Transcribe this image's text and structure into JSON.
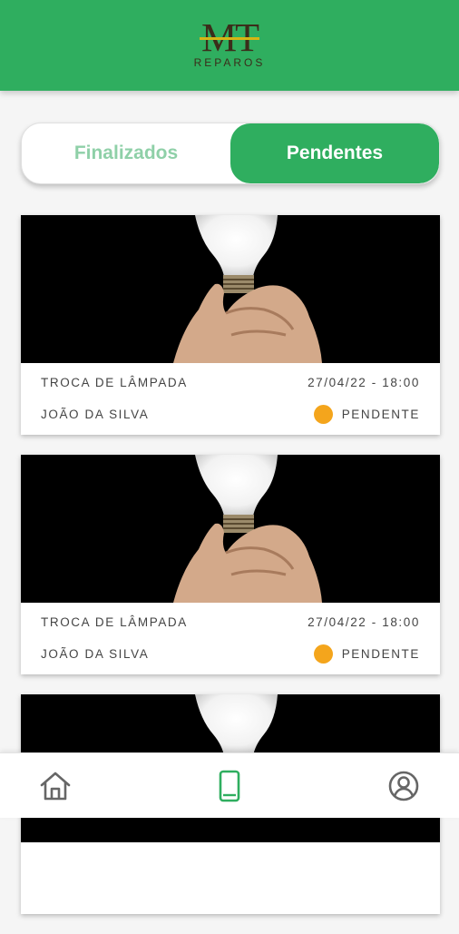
{
  "app": {
    "logo_text": "MT",
    "logo_subtitle": "REPAROS"
  },
  "tabs": [
    {
      "label": "Finalizados",
      "active": false
    },
    {
      "label": "Pendentes",
      "active": true
    }
  ],
  "services": [
    {
      "title": "TROCA DE LÂMPADA",
      "datetime": "27/04/22 - 18:00",
      "client": "JOÃO DA SILVA",
      "status": "PENDENTE",
      "image": "light-bulb-photo"
    },
    {
      "title": "TROCA DE LÂMPADA",
      "datetime": "27/04/22 - 18:00",
      "client": "JOÃO DA SILVA",
      "status": "PENDENTE",
      "image": "light-bulb-photo"
    },
    {
      "title": "",
      "datetime": "",
      "client": "",
      "status": "",
      "image": "light-bulb-photo"
    }
  ],
  "bottom_nav": [
    {
      "icon": "home-icon",
      "active": false
    },
    {
      "icon": "tablet-icon",
      "active": true
    },
    {
      "icon": "profile-icon",
      "active": false
    }
  ],
  "colors": {
    "primary": "#2fae5f",
    "status_pending": "#f4a51c",
    "tab_inactive_text": "#8fd0a8"
  }
}
